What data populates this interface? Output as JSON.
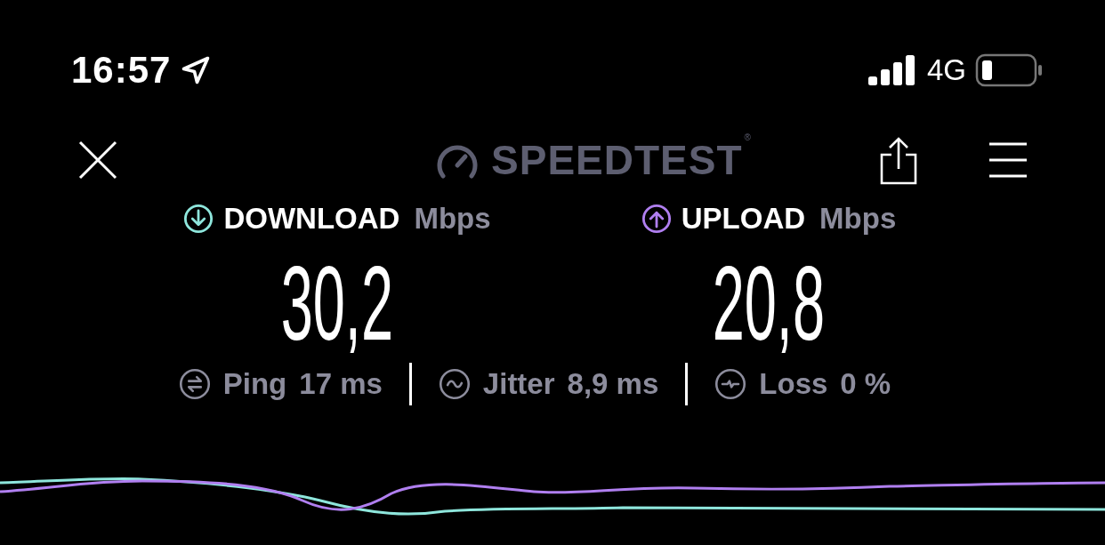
{
  "status_bar": {
    "time": "16:57",
    "network": "4G"
  },
  "header": {
    "title": "SPEEDTEST",
    "mark": "®"
  },
  "results": [
    {
      "kind": "download",
      "label": "DOWNLOAD",
      "unit": "Mbps",
      "value": "30,2",
      "color": "#8ee6dc"
    },
    {
      "kind": "upload",
      "label": "UPLOAD",
      "unit": "Mbps",
      "value": "20,8",
      "color": "#b07ff0"
    }
  ],
  "metrics": [
    {
      "kind": "ping",
      "label": "Ping",
      "value": "17",
      "unit": "ms"
    },
    {
      "kind": "jitter",
      "label": "Jitter",
      "value": "8,9",
      "unit": "ms"
    },
    {
      "kind": "loss",
      "label": "Loss",
      "value": "0",
      "unit": "%"
    }
  ]
}
